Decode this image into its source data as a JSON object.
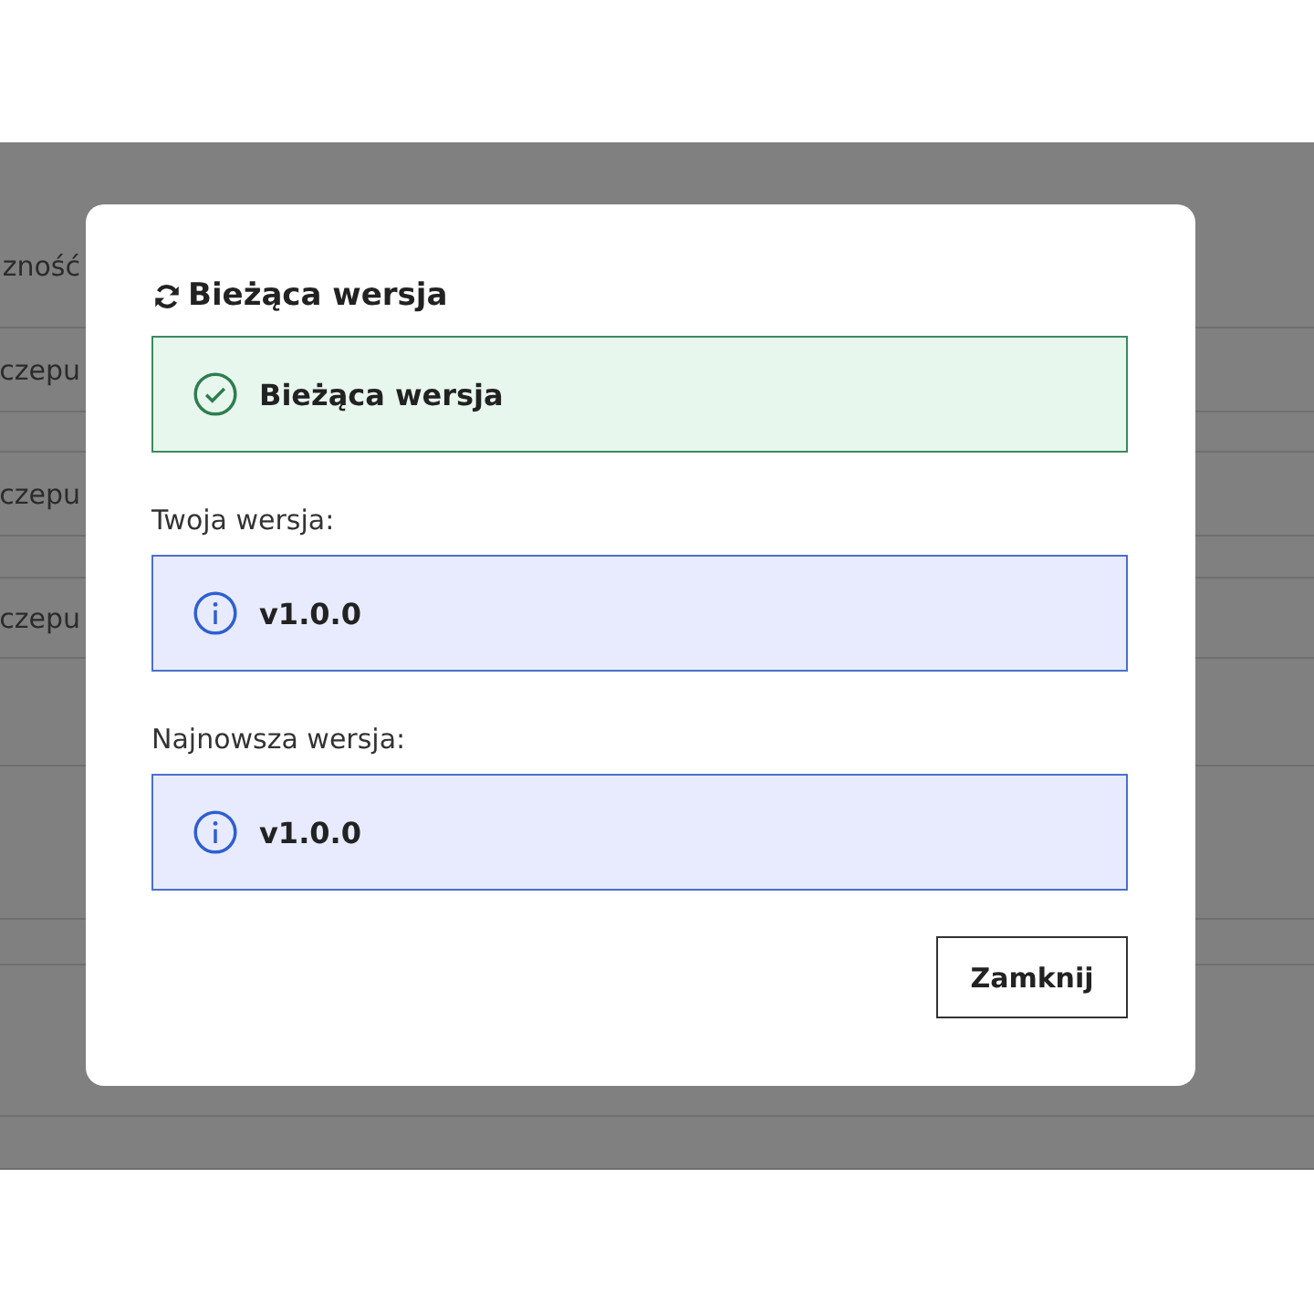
{
  "background": {
    "rows": [
      {
        "label": "zność"
      },
      {
        "label": "czepu"
      },
      {
        "label": "czepu"
      },
      {
        "label": "czepu"
      }
    ]
  },
  "dialog": {
    "title": "Bieżąca wersja",
    "status": {
      "kind": "success",
      "text": "Bieżąca wersja"
    },
    "fields": [
      {
        "label": "Twoja wersja:",
        "kind": "info",
        "value": "v1.0.0"
      },
      {
        "label": "Najnowsza wersja:",
        "kind": "info",
        "value": "v1.0.0"
      }
    ],
    "buttons": [
      {
        "label": "Zamknij"
      }
    ]
  }
}
